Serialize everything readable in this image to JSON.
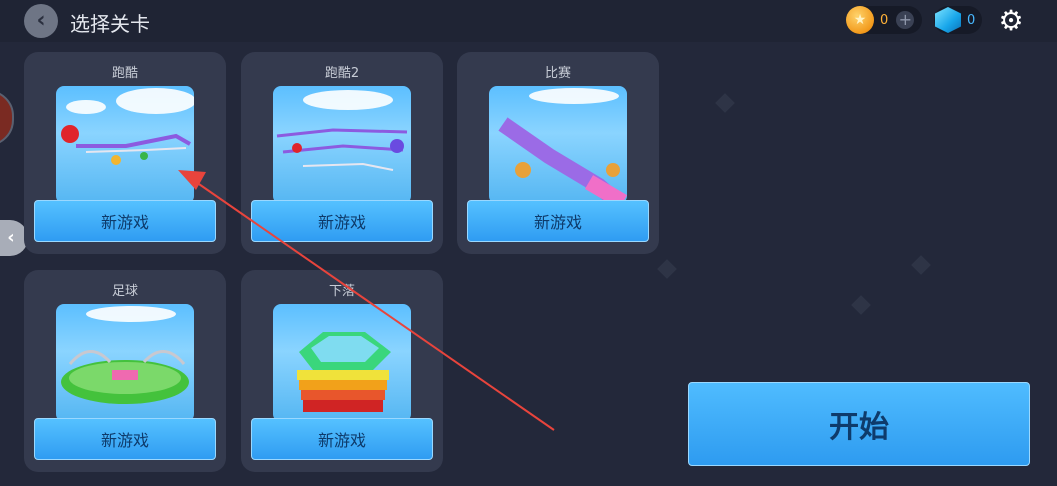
{
  "header": {
    "title": "选择关卡",
    "back_icon": "chevron-left-icon",
    "coins": "0",
    "gems": "0",
    "plus_symbol": "+",
    "settings_icon": "gear-icon"
  },
  "levels": [
    {
      "name": "跑酷",
      "button_label": "新游戏",
      "theme": "parkour"
    },
    {
      "name": "跑酷2",
      "button_label": "新游戏",
      "theme": "parkour2"
    },
    {
      "name": "比赛",
      "button_label": "新游戏",
      "theme": "race"
    },
    {
      "name": "足球",
      "button_label": "新游戏",
      "theme": "soccer"
    },
    {
      "name": "下落",
      "button_label": "新游戏",
      "theme": "fall"
    }
  ],
  "start_label": "开始",
  "colors": {
    "background": "#23283a",
    "card": "#343a4e",
    "button": "#3aa9f6",
    "annotation_arrow": "#e8443c"
  }
}
